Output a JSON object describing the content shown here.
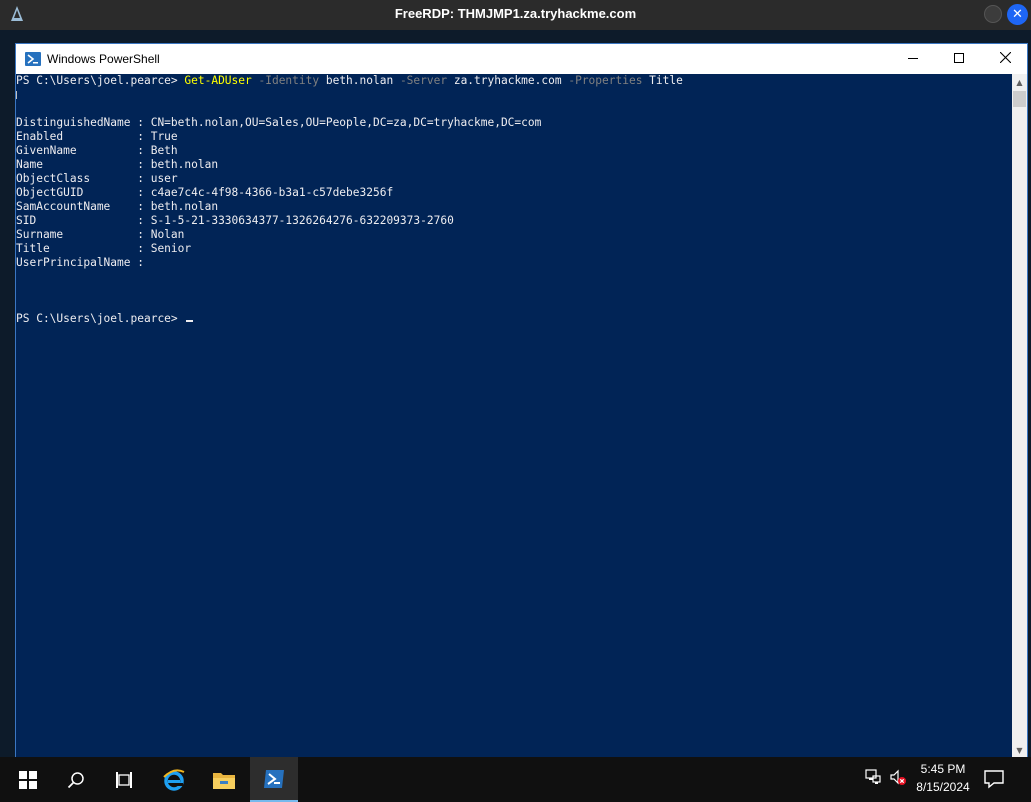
{
  "rdp": {
    "title": "FreeRDP: THMJMP1.za.tryhackme.com"
  },
  "window": {
    "title": "Windows PowerShell"
  },
  "console": {
    "prompt": "PS C:\\Users\\joel.pearce> ",
    "command": {
      "cmdlet": "Get-ADUser",
      "p1": " -Identity",
      "v1": " beth.nolan",
      "p2": " -Server",
      "v2": " za.tryhackme.com",
      "p3": " -Properties",
      "v3": " Title"
    },
    "output": [
      "DistinguishedName : CN=beth.nolan,OU=Sales,OU=People,DC=za,DC=tryhackme,DC=com",
      "Enabled           : True",
      "GivenName         : Beth",
      "Name              : beth.nolan",
      "ObjectClass       : user",
      "ObjectGUID        : c4ae7c4c-4f98-4366-b3a1-c57debe3256f",
      "SamAccountName    : beth.nolan",
      "SID               : S-1-5-21-3330634377-1326264276-632209373-2760",
      "Surname           : Nolan",
      "Title             : Senior",
      "UserPrincipalName :"
    ],
    "final_prompt": "PS C:\\Users\\joel.pearce> "
  },
  "taskbar": {
    "time": "5:45 PM",
    "date": "8/15/2024",
    "icons": [
      "windows-start-icon",
      "search-icon",
      "task-view-icon",
      "internet-explorer-icon",
      "file-explorer-icon",
      "powershell-icon"
    ]
  },
  "colors": {
    "console_bg": "#012456",
    "console_fg": "#eeedf0",
    "cmdlet": "#ffff00",
    "param": "#808080"
  }
}
